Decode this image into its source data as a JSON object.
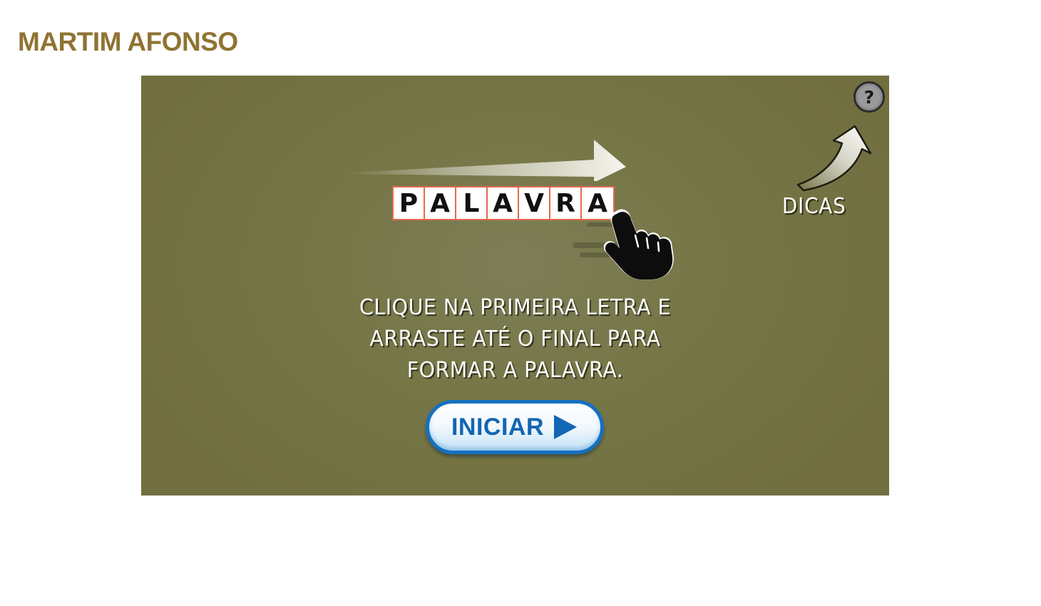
{
  "header": {
    "title": "MARTIM AFONSO"
  },
  "game": {
    "example_word": [
      "P",
      "A",
      "L",
      "A",
      "V",
      "R",
      "A"
    ],
    "hints_label": "DICAS",
    "help_symbol": "?",
    "instructions": [
      "CLIQUE NA PRIMEIRA LETRA E",
      "ARRASTE ATÉ O FINAL PARA",
      "FORMAR A PALAVRA."
    ],
    "start_label": "INICIAR"
  },
  "colors": {
    "title": "#8f7332",
    "stage_background": "#767647",
    "tile_border": "#e26a4f",
    "start_button_border": "#1471c0",
    "start_button_text": "#1266b3"
  },
  "icons": {
    "help": "question-mark-icon",
    "hints_arrow": "curved-arrow-icon",
    "swipe": "swipe-arrow-icon",
    "pointer": "hand-pointer-icon",
    "play": "play-triangle-icon"
  }
}
